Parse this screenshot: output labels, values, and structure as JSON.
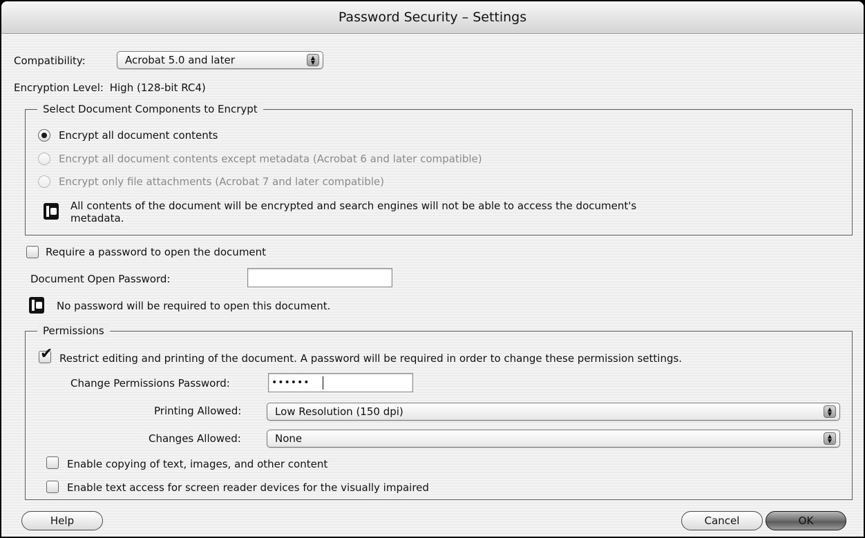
{
  "window": {
    "title": "Password Security – Settings"
  },
  "compatibility": {
    "label": "Compatibility:",
    "selected": "Acrobat 5.0 and later"
  },
  "encryption": {
    "label": "Encryption  Level:",
    "value": "High (128-bit RC4)"
  },
  "components": {
    "group_label": "Select Document Components to Encrypt",
    "options": [
      {
        "label": "Encrypt all document contents",
        "selected": true,
        "enabled": true
      },
      {
        "label": "Encrypt all document contents except metadata (Acrobat 6 and later compatible)",
        "selected": false,
        "enabled": false
      },
      {
        "label": "Encrypt only file attachments (Acrobat 7 and later compatible)",
        "selected": false,
        "enabled": false
      }
    ],
    "info_line1": "All contents of the document will be encrypted and search engines will not be able to access the document's",
    "info_line2": "metadata."
  },
  "open_password": {
    "require_label": "Require a password to open the document",
    "require_checked": false,
    "field_label": "Document Open Password:",
    "field_value": "",
    "info": "No password will be required to open this document."
  },
  "permissions": {
    "group_label": "Permissions",
    "restrict_label": "Restrict editing and printing of the document. A password will be required in order to change these permission settings.",
    "restrict_checked": true,
    "password_label": "Change Permissions Password:",
    "password_value": "••••••",
    "printing_label": "Printing Allowed:",
    "printing_value": "Low Resolution (150 dpi)",
    "changes_label": "Changes Allowed:",
    "changes_value": "None",
    "copy_label": "Enable copying of text, images, and other content",
    "copy_checked": false,
    "screenreader_label": "Enable text access for screen reader devices for the visually impaired",
    "screenreader_checked": false
  },
  "buttons": {
    "help": "Help",
    "cancel": "Cancel",
    "ok": "OK"
  },
  "icons": {
    "info": "info-note-icon",
    "popup_arrows": "up-down-arrows-icon",
    "checkmark": "checkmark-icon"
  }
}
